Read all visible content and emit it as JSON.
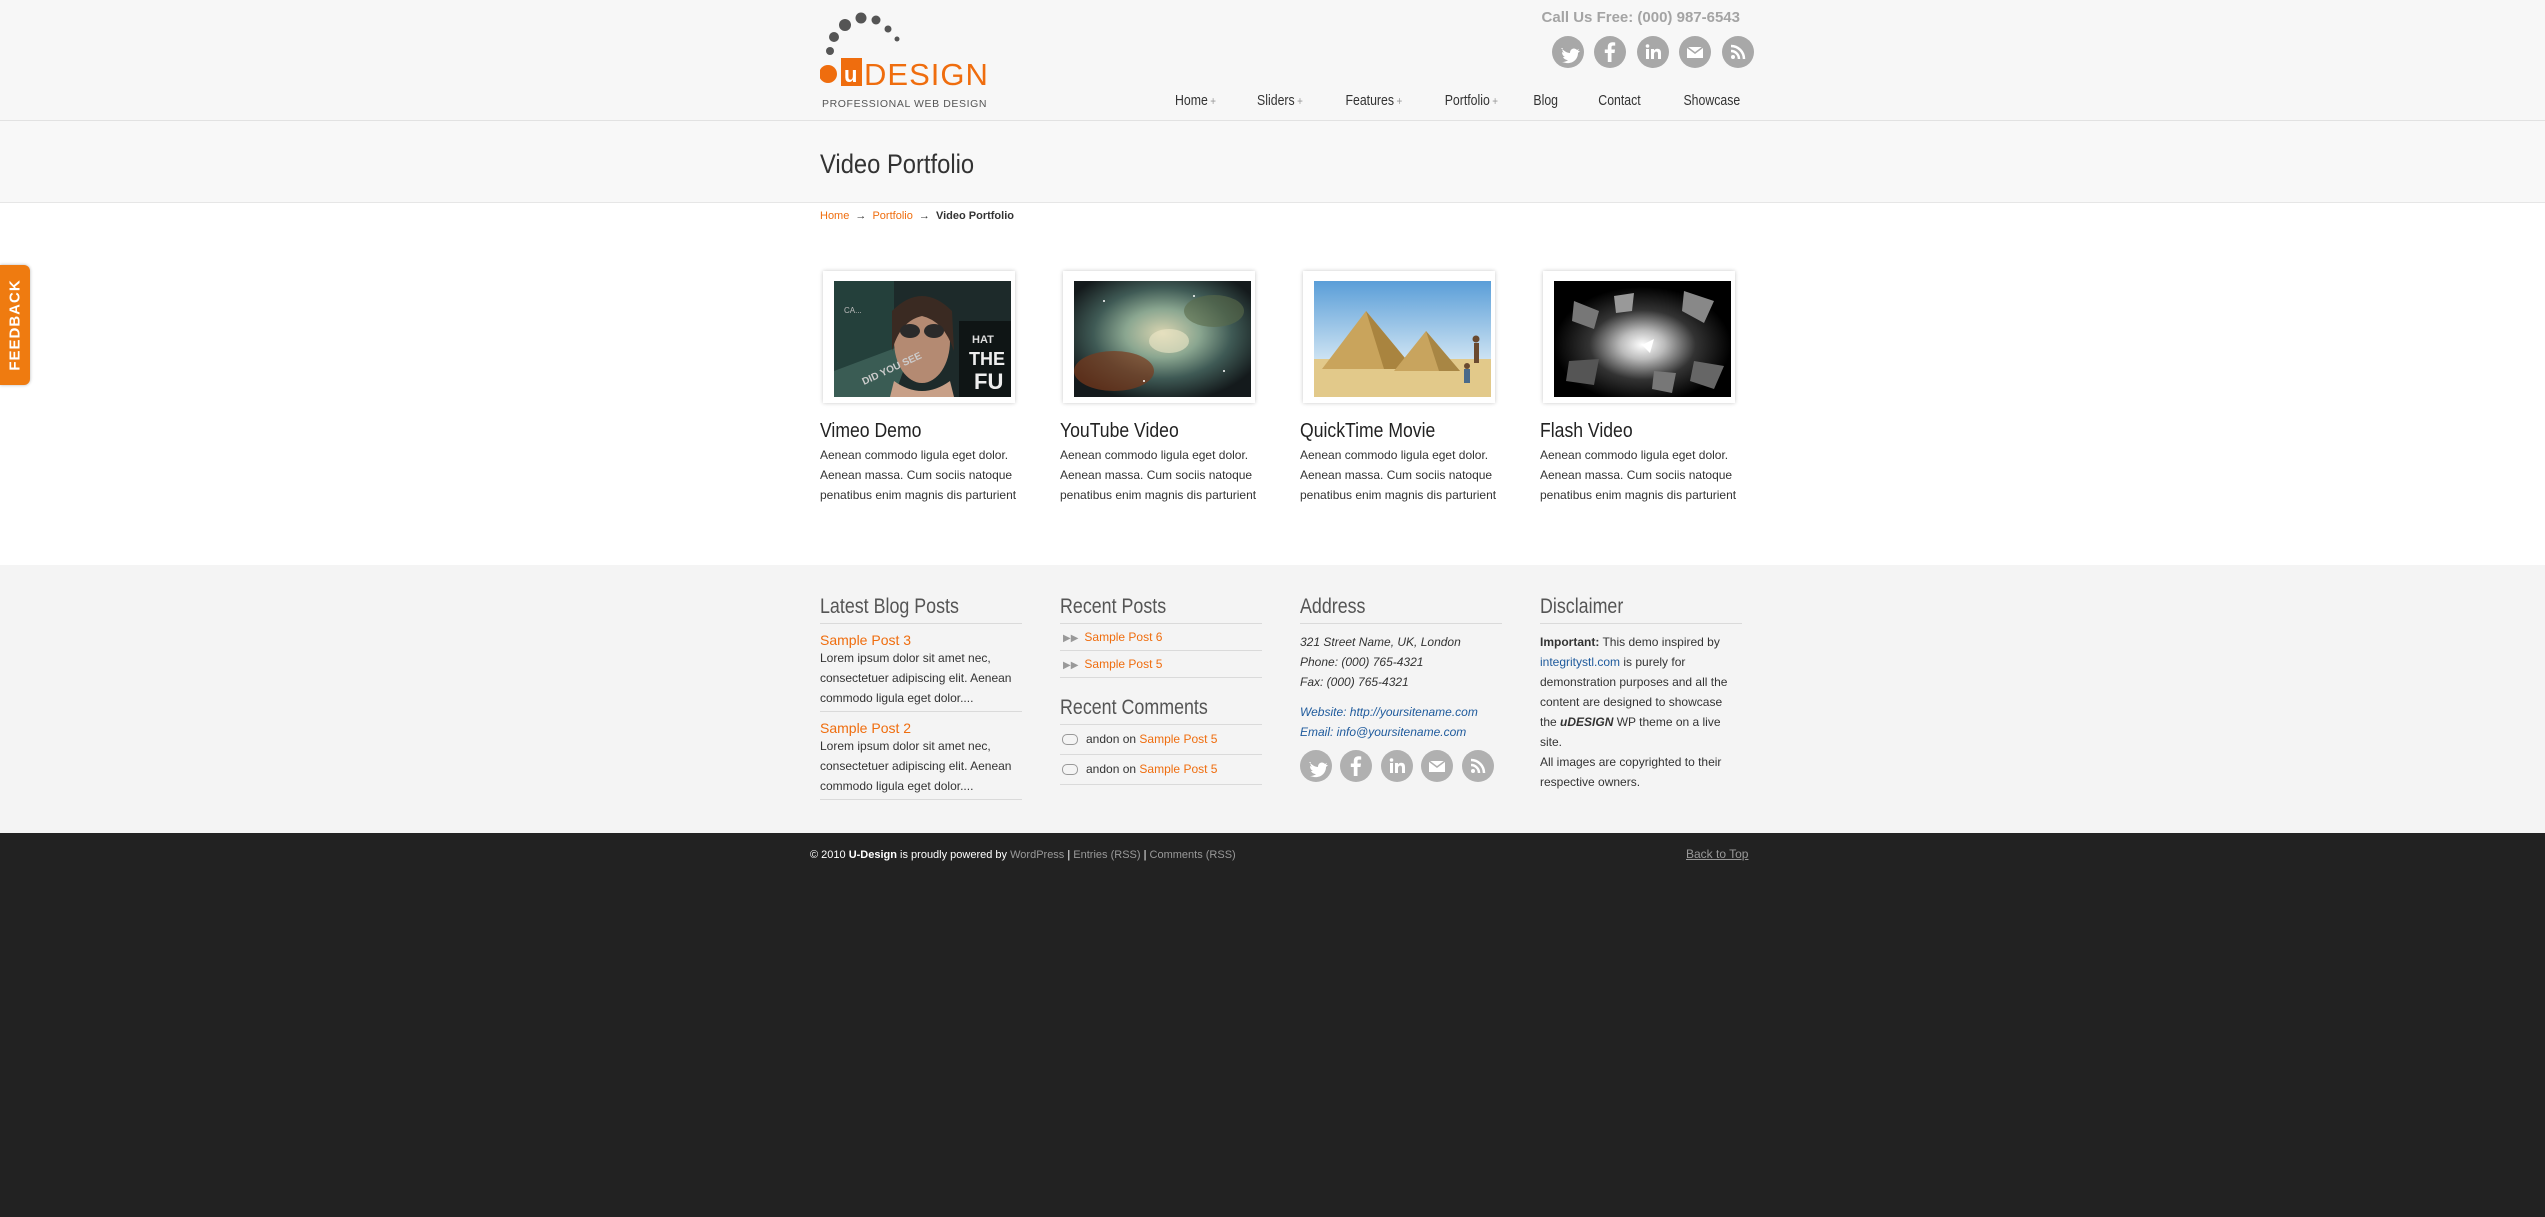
{
  "header": {
    "logo_tagline": "PROFESSIONAL WEB DESIGN",
    "phone": "Call Us Free: (000) 987-6543",
    "social_icons": [
      "twitter-icon",
      "facebook-icon",
      "linkedin-icon",
      "email-icon",
      "rss-icon"
    ],
    "nav": [
      {
        "label": "Home",
        "has_sub": true
      },
      {
        "label": "Sliders",
        "has_sub": true
      },
      {
        "label": "Features",
        "has_sub": true
      },
      {
        "label": "Portfolio",
        "has_sub": true
      },
      {
        "label": "Blog",
        "has_sub": false
      },
      {
        "label": "Contact",
        "has_sub": false
      },
      {
        "label": "Showcase",
        "has_sub": false
      }
    ],
    "nav_plus": "+"
  },
  "page": {
    "title": "Video Portfolio",
    "breadcrumb": {
      "home": "Home",
      "sep": "→",
      "portfolio": "Portfolio",
      "current": "Video Portfolio"
    }
  },
  "portfolio": [
    {
      "title": "Vimeo Demo",
      "desc": "Aenean commodo ligula eget dolor. Aenean massa. Cum sociis natoque penatibus enim magnis dis parturient"
    },
    {
      "title": "YouTube Video",
      "desc": "Aenean commodo ligula eget dolor. Aenean massa. Cum sociis natoque penatibus enim magnis dis parturient"
    },
    {
      "title": "QuickTime Movie",
      "desc": "Aenean commodo ligula eget dolor. Aenean massa. Cum sociis natoque penatibus enim magnis dis parturient"
    },
    {
      "title": "Flash Video",
      "desc": "Aenean commodo ligula eget dolor. Aenean massa. Cum sociis natoque penatibus enim magnis dis parturient"
    }
  ],
  "feedback_label": "FEEDBACK",
  "widgets": {
    "latest": {
      "title": "Latest Blog Posts",
      "posts": [
        {
          "title": "Sample Post 3",
          "excerpt": "Lorem ipsum dolor sit amet nec, consectetuer adipiscing elit. Aenean commodo ligula eget dolor...."
        },
        {
          "title": "Sample Post 2",
          "excerpt": "Lorem ipsum dolor sit amet nec, consectetuer adipiscing elit. Aenean commodo ligula eget dolor...."
        }
      ]
    },
    "recent_posts": {
      "title": "Recent Posts",
      "items": [
        "Sample Post 6",
        "Sample Post 5"
      ]
    },
    "recent_comments": {
      "title": "Recent Comments",
      "items": [
        {
          "author": "andon",
          "on": "on",
          "post": "Sample Post 5"
        },
        {
          "author": "andon",
          "on": "on",
          "post": "Sample Post 5"
        }
      ]
    },
    "address": {
      "title": "Address",
      "street": "321 Street Name, UK, London",
      "phone": "Phone: (000) 765-4321",
      "fax": "Fax: (000) 765-4321",
      "website": "Website: http://yoursitename.com",
      "email": "Email: info@yoursitename.com"
    },
    "disclaimer": {
      "title": "Disclaimer",
      "important": "Important:",
      "text1": " This demo inspired by ",
      "link": "integritystl.com",
      "text2": " is purely for demonstration purposes and all the content are designed to showcase the ",
      "brand": "uDESIGN",
      "text3": " WP theme on a live site.",
      "text4": "All images are copyrighted to their respective owners."
    }
  },
  "footer": {
    "copy_prefix": "© 2010 ",
    "brand": "U-Design",
    "powered": " is proudly powered by ",
    "wordpress": "WordPress",
    "pipe": " | ",
    "entries": "Entries (RSS)",
    "comments": "Comments (RSS)",
    "back_to_top": "Back to Top"
  },
  "colors": {
    "accent": "#ef6d0e",
    "link_blue": "#1e5a9c",
    "footer_bg": "#222222",
    "icon_grey": "#a8a8a8"
  }
}
